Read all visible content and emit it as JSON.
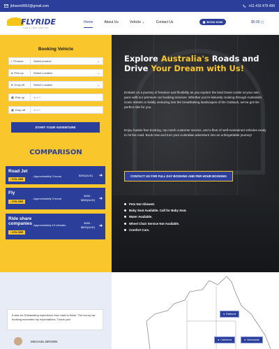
{
  "topbar": {
    "email": "jbhsem9952@gmail.com",
    "phone": "+61 416 479 499"
  },
  "nav": {
    "logo_name": "FLYRIDE",
    "logo_tag": "CAR & LIMO SERVICE",
    "items": [
      "Home",
      "About Us",
      "Vehicle",
      "Contact Us"
    ],
    "book_label": "BOOK NOW",
    "cart": "$0.00"
  },
  "booking": {
    "title": "Booking Vehicle",
    "rows": [
      {
        "label": "Product",
        "value": "Select product",
        "dropdown": true
      },
      {
        "label": "Pick-up",
        "value": "Select Location",
        "dropdown": true
      },
      {
        "label": "Drop-off",
        "value": "Select Location",
        "dropdown": true
      },
      {
        "label": "Pick-up",
        "value": "d m Y",
        "dropdown": false
      },
      {
        "label": "Drop-off",
        "value": "d m Y",
        "dropdown": false
      }
    ],
    "button": "START YOUR ADVENTURE"
  },
  "comparison": {
    "title": "COMPARISON",
    "cards": [
      {
        "title": "Road Jet",
        "badge": "SYD-CBR",
        "approx": "- Approximately 3 hours",
        "price": "$390(AUD)"
      },
      {
        "title": "Fly",
        "badge": "SYD-CBR",
        "approx": "- Approximately 3 hours",
        "price": "$450 - $550(AUD)"
      },
      {
        "title": "Ride share companies",
        "badge": "SYD-CBR",
        "approx": "- Approximately 15 minutes",
        "price": "$450 - $600(AUD)"
      }
    ]
  },
  "hero": {
    "title_a": "Explore ",
    "title_b": "Australia's",
    "title_c": " Roads and Drive ",
    "title_d": "Your Dream with Us!",
    "p1": "Embark on a journey of freedom and flexibility as you explore the land Down Under at your own pace with our premium car booking services. Whether you're leisurely cruising through Australia's iconic streets or boldly venturing into the breathtaking landscapes of the Outback, we've got the perfect ride for you.",
    "p2": "Enjoy hassle-free booking, top-notch customer service, and a fleet of well-maintained vehicles ready to hit the road. Book now and turn your Australian adventure into an unforgettable journey!",
    "button": "CONTACT US FOR FULL DAY BOOKING AND PER HOUR BOOKING",
    "features": [
      "Pets Not Allowed.",
      "Baby Seat Available. Call for Baby Seat.",
      "Water Available.",
      "Wheel Chair Service Not Available.",
      "Comfort Cars."
    ]
  },
  "testimonial": {
    "text": "It was an Outstanding experience from start to finish. The luxury car booking exceeded my expectations. Thank you!",
    "author": "MICHAEL BROWN"
  },
  "map": {
    "pins": [
      "Bathurst",
      "Canberra",
      "Newcastle"
    ]
  },
  "colors": {
    "blue": "#2b3f9a",
    "yellow": "#f9c62c"
  }
}
